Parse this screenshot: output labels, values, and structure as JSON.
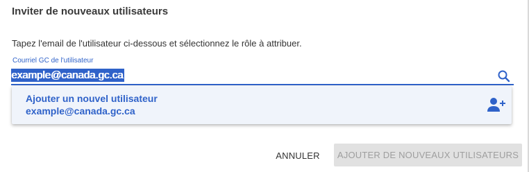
{
  "dialog": {
    "title": "Inviter de nouveaux utilisateurs",
    "instruction": "Tapez l'email de l'utilisateur ci-dessous et sélectionnez le rôle à attribuer."
  },
  "email_field": {
    "label": "Courriel GC de l'utilisateur",
    "value": "example@canada.gc.ca",
    "selected_text": "example@canada.gc.ca",
    "search_icon": "search-icon"
  },
  "suggestion": {
    "title": "Ajouter un nouvel utilisateur",
    "email": "example@canada.gc.ca",
    "icon": "add-user-icon"
  },
  "actions": {
    "cancel_label": "ANNULER",
    "submit_label": "AJOUTER DE NOUVEAUX UTILISATEURS",
    "submit_disabled": true
  },
  "colors": {
    "accent": "#2f62c9",
    "suggestion_bg": "#f0f4fb",
    "disabled_bg": "#e1e1e1",
    "disabled_text": "#9e9e9e"
  }
}
